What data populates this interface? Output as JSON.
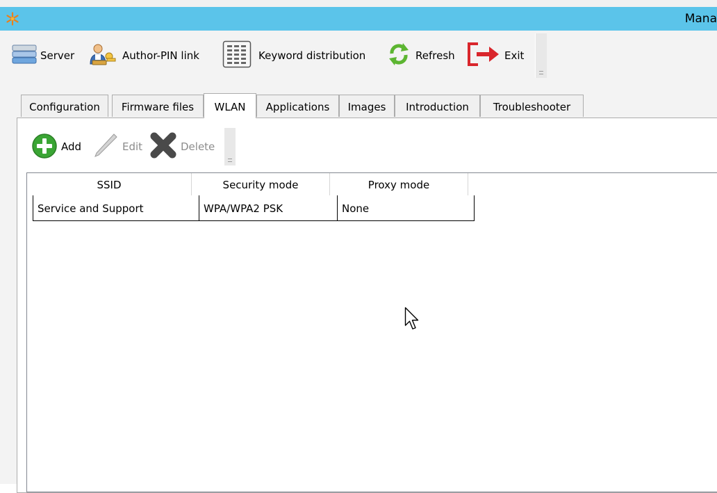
{
  "window": {
    "title": "Mana",
    "app_icon": "snowflake-asterisk-icon",
    "title_bar_color": "#5bc4ea"
  },
  "toolbar": {
    "items": [
      {
        "label": "Server",
        "icon": "server-stack-icon"
      },
      {
        "label": "Author-PIN link",
        "icon": "user-key-icon"
      },
      {
        "label": "Keyword distribution",
        "icon": "grid-table-icon"
      },
      {
        "label": "Refresh",
        "icon": "refresh-arrows-icon"
      },
      {
        "label": "Exit",
        "icon": "exit-arrow-icon"
      }
    ]
  },
  "tabs": [
    {
      "label": "Configuration",
      "active": false
    },
    {
      "label": "Firmware files",
      "active": false
    },
    {
      "label": "WLAN",
      "active": true
    },
    {
      "label": "Applications",
      "active": false
    },
    {
      "label": "Images",
      "active": false
    },
    {
      "label": "Introduction",
      "active": false
    },
    {
      "label": "Troubleshooter",
      "active": false
    }
  ],
  "wlan_toolbar": {
    "add_label": "Add",
    "edit_label": "Edit",
    "delete_label": "Delete",
    "add_enabled": true,
    "edit_enabled": false,
    "delete_enabled": false
  },
  "wlan_table": {
    "columns": [
      "SSID",
      "Security mode",
      "Proxy mode"
    ],
    "rows": [
      [
        "Service and Support",
        "WPA/WPA2 PSK",
        "None"
      ]
    ]
  },
  "colors": {
    "accent": "#5bc4ea",
    "add_green": "#3aa534",
    "exit_red": "#d9262c",
    "refresh_green": "#5cb531"
  }
}
